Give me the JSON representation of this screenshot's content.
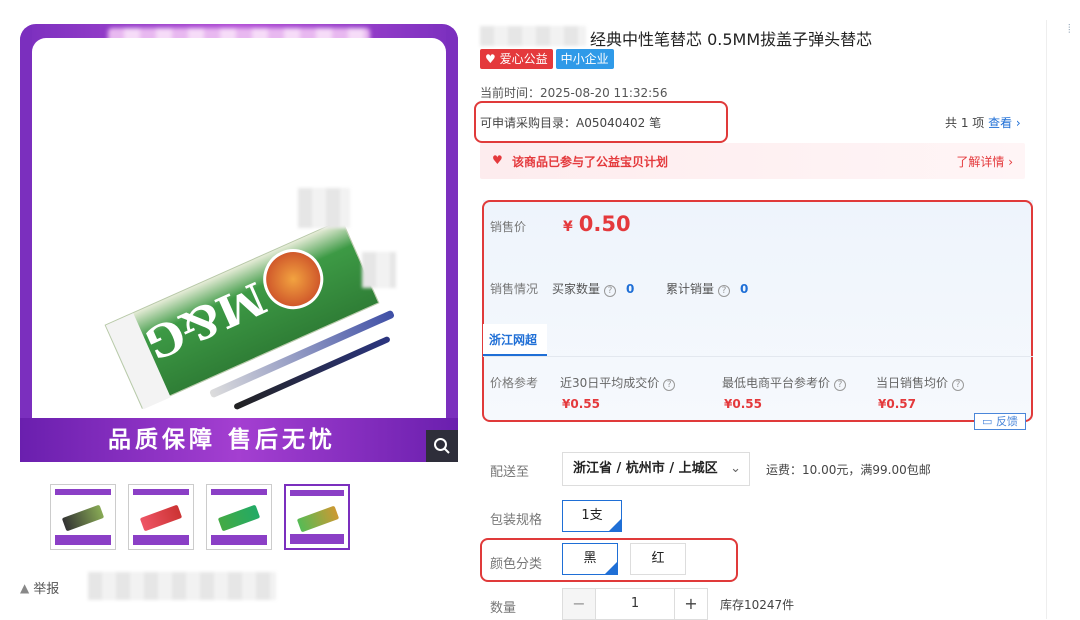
{
  "product": {
    "title": "经典中性笔替芯 0.5MM拔盖子弹头替芯",
    "tags": [
      {
        "label": "爱心公益",
        "color": "#e4393c"
      },
      {
        "label": "中小企业",
        "color": "#2f9ae8"
      }
    ],
    "current_time": "当前时间：2025-08-20 11:32:56",
    "catalog": "可申请采购目录：A05040402 笔",
    "catalog_count_prefix": "共 1 项",
    "catalog_view": "查看",
    "charity_text": "该商品已参与了公益宝贝计划",
    "charity_more": "了解详情"
  },
  "image": {
    "banner_text": "品质保障 售后无忧",
    "zoom_icon": "magnifier-icon"
  },
  "report_label": "举报",
  "price": {
    "label": "销售价",
    "symbol": "¥",
    "value": "0.50",
    "sales_label": "销售情况",
    "buyers_label": "买家数量",
    "buyers_value": "0",
    "total_sold_label": "累计销量",
    "total_sold_value": "0",
    "region_tab": "浙江网超",
    "ref_label": "价格参考",
    "ref": [
      {
        "label": "近30日平均成交价",
        "value": "¥0.55"
      },
      {
        "label": "最低电商平台参考价",
        "value": "¥0.55"
      },
      {
        "label": "当日销售均价",
        "value": "¥0.57"
      }
    ],
    "feedback": "反馈"
  },
  "delivery": {
    "label": "配送至",
    "region": "浙江省 / 杭州市 / 上城区",
    "shipping": "运费：10.00元，满99.00包邮"
  },
  "packaging": {
    "label": "包装规格",
    "options": [
      "1支"
    ]
  },
  "color": {
    "label": "颜色分类",
    "options": [
      "黑",
      "红"
    ]
  },
  "quantity": {
    "label": "数量",
    "value": "1",
    "minus": "−",
    "plus": "+",
    "stock": "库存10247件"
  },
  "accent": "#e4393c",
  "link_color": "#1f6fd6"
}
